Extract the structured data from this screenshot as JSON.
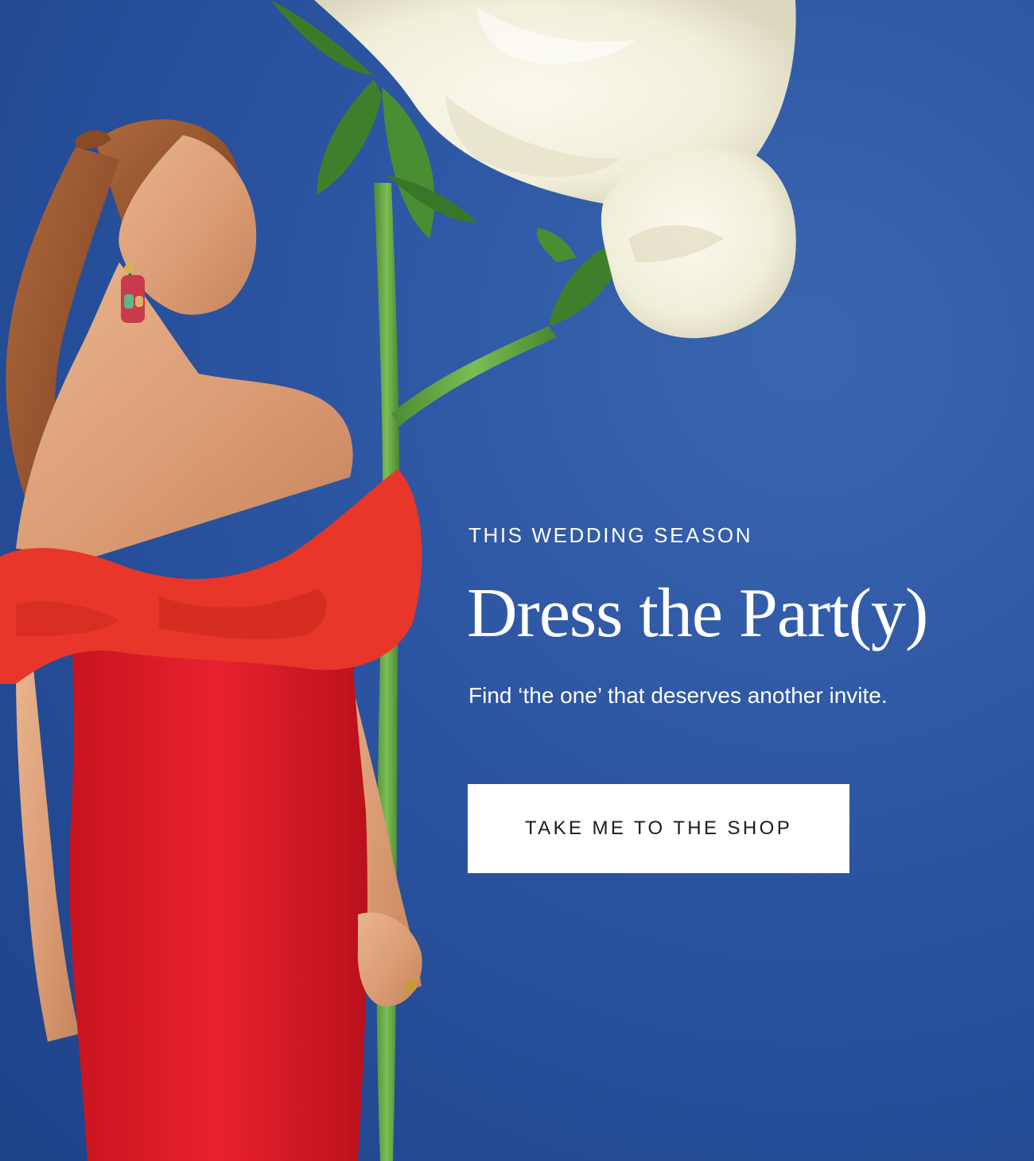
{
  "hero": {
    "eyebrow": "THIS WEDDING SEASON",
    "headline": "Dress the Part(y)",
    "subhead": "Find ‘the one’ that deserves another invite.",
    "cta_label": "TAKE ME TO THE SHOP"
  },
  "colors": {
    "background": "#2a52a0",
    "dress": "#e0202c",
    "rose": "#f5f2e3",
    "stem": "#5e9e3c",
    "button_bg": "#ffffff",
    "button_text": "#1b1b1b",
    "text": "#ffffff"
  }
}
